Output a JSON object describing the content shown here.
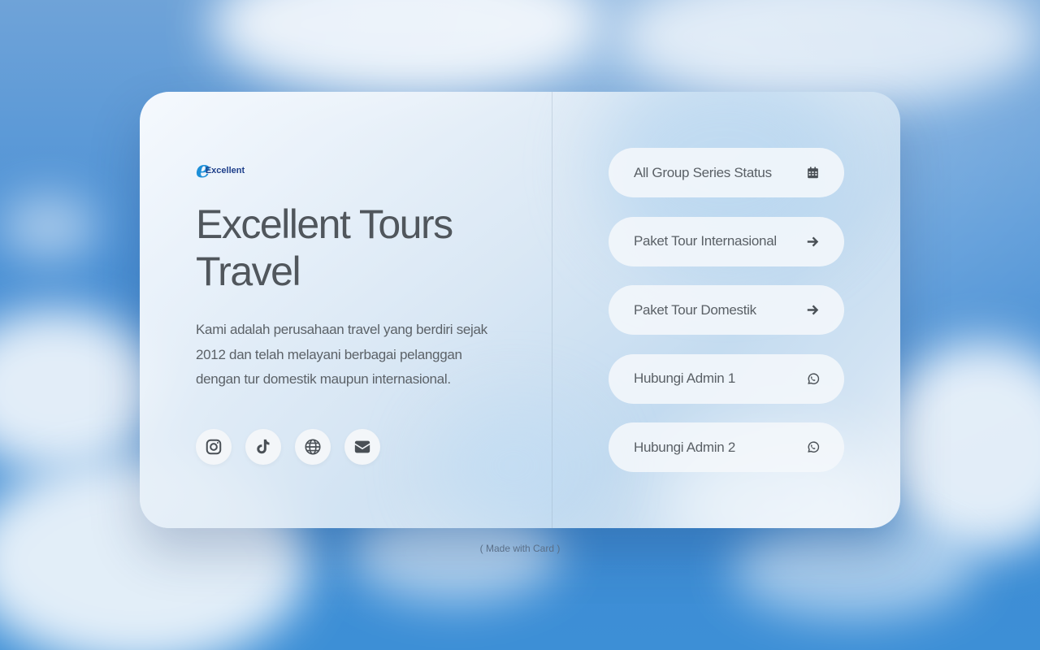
{
  "brand": {
    "logo_letter": "e",
    "logo_text": "Excellent"
  },
  "title": "Excellent Tours Travel",
  "description": "Kami adalah perusahaan travel yang berdiri sejak 2012 dan telah melayani berbagai pelanggan dengan tur domestik maupun internasional.",
  "socials": [
    {
      "icon": "instagram-icon"
    },
    {
      "icon": "tiktok-icon"
    },
    {
      "icon": "globe-icon"
    },
    {
      "icon": "envelope-icon"
    }
  ],
  "links": [
    {
      "label": "All Group Series Status",
      "icon": "calendar-icon"
    },
    {
      "label": "Paket Tour Internasional",
      "icon": "arrow-right-icon"
    },
    {
      "label": "Paket Tour Domestik",
      "icon": "arrow-right-icon"
    },
    {
      "label": "Hubungi Admin 1",
      "icon": "whatsapp-icon"
    },
    {
      "label": "Hubungi Admin 2",
      "icon": "whatsapp-icon"
    }
  ],
  "footer": "( Made with Card )",
  "colors": {
    "text": "#50565c",
    "icon": "#4a5056",
    "sky": "#3f8ad3"
  }
}
